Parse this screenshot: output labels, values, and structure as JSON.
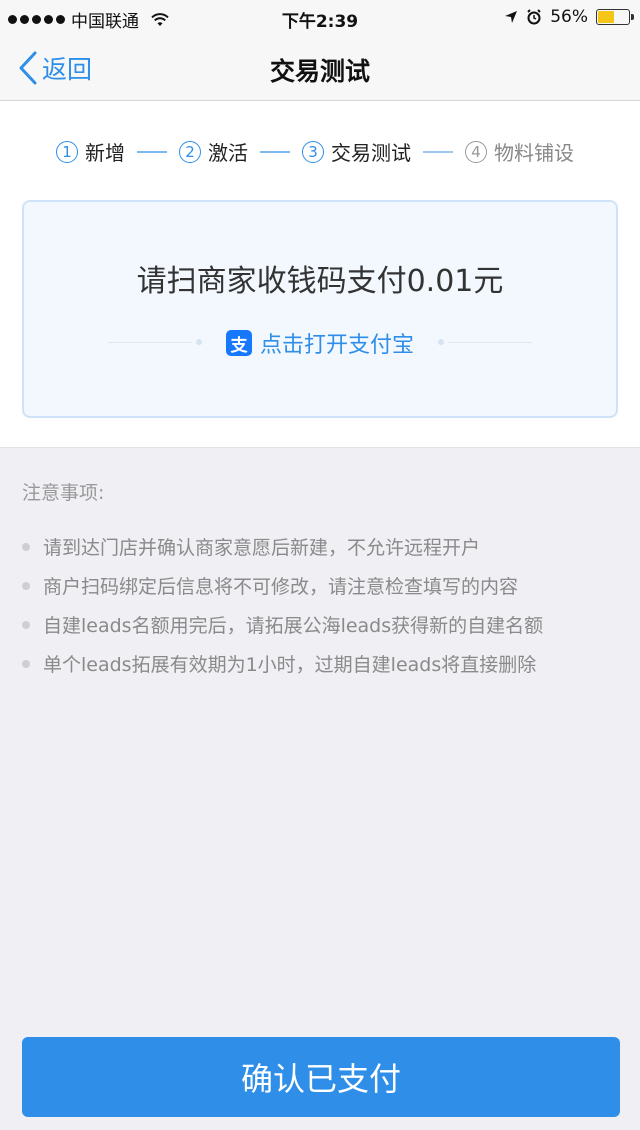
{
  "status_bar": {
    "carrier": "中国联通",
    "time": "下午2:39",
    "battery_percent_text": "56%",
    "battery_level": 0.56
  },
  "nav": {
    "back_label": "返回",
    "title": "交易测试"
  },
  "steps": [
    {
      "num": "1",
      "label": "新增"
    },
    {
      "num": "2",
      "label": "激活"
    },
    {
      "num": "3",
      "label": "交易测试"
    },
    {
      "num": "4",
      "label": "物料铺设"
    }
  ],
  "card": {
    "prompt": "请扫商家收钱码支付0.01元",
    "open_alipay_label": "点击打开支付宝",
    "alipay_icon_glyph": "支"
  },
  "notes": {
    "heading": "注意事项:",
    "items": [
      "请到达门店并确认商家意愿后新建，不允许远程开户",
      "商户扫码绑定后信息将不可修改，请注意检查填写的内容",
      "自建leads名额用完后，请拓展公海leads获得新的自建名额",
      "单个leads拓展有效期为1小时，过期自建leads将直接删除"
    ]
  },
  "confirm_button_label": "确认已支付",
  "colors": {
    "accent": "#2e8ee8",
    "battery": "#f5c518"
  }
}
